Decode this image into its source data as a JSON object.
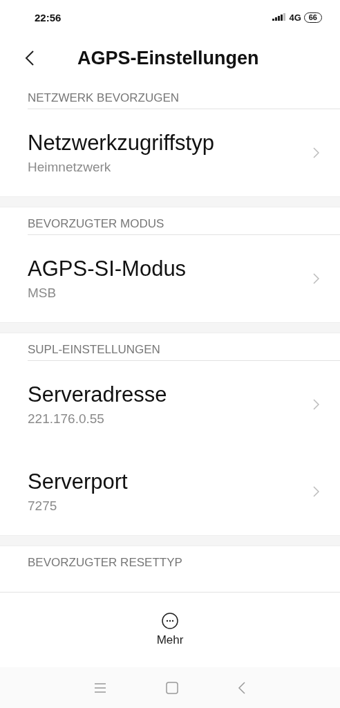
{
  "status_bar": {
    "time": "22:56",
    "network": "4G",
    "battery": "66"
  },
  "header": {
    "title": "AGPS-Einstellungen"
  },
  "sections": [
    {
      "header": "NETZWERK BEVORZUGEN",
      "items": [
        {
          "title": "Netzwerkzugriffstyp",
          "value": "Heimnetzwerk"
        }
      ]
    },
    {
      "header": "BEVORZUGTER MODUS",
      "items": [
        {
          "title": "AGPS-SI-Modus",
          "value": "MSB"
        }
      ]
    },
    {
      "header": "SUPL-EINSTELLUNGEN",
      "items": [
        {
          "title": "Serveradresse",
          "value": "221.176.0.55"
        },
        {
          "title": "Serverport",
          "value": "7275"
        }
      ]
    },
    {
      "header": "BEVORZUGTER RESETTYP"
    }
  ],
  "bottom_bar": {
    "label": "Mehr"
  }
}
